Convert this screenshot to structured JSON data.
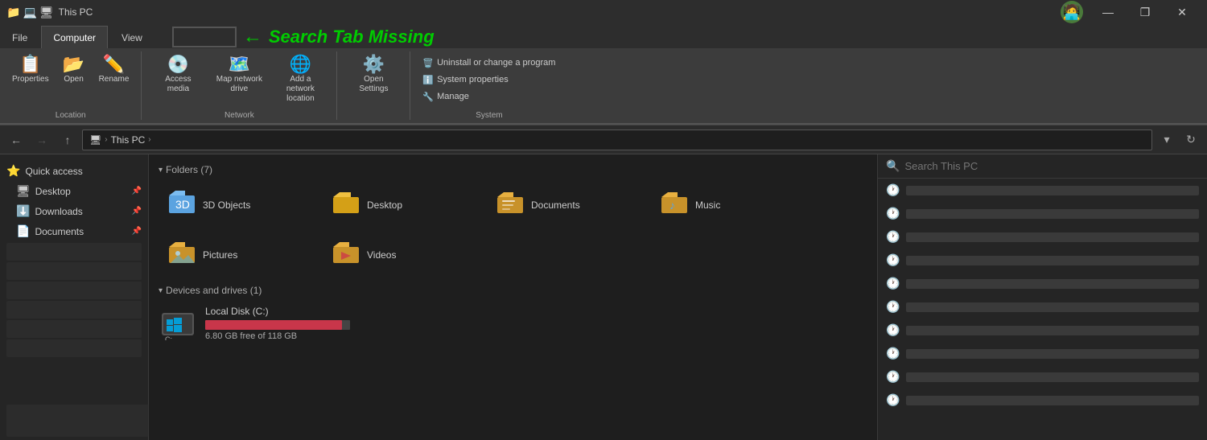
{
  "titleBar": {
    "title": "This PC",
    "icons": [
      "📁",
      "💻",
      "🖥"
    ],
    "controls": [
      "—",
      "❐",
      "✕"
    ]
  },
  "ribbonTabs": [
    {
      "label": "File",
      "active": false
    },
    {
      "label": "Computer",
      "active": true
    },
    {
      "label": "View",
      "active": false
    }
  ],
  "ribbon": {
    "groups": [
      {
        "label": "Location",
        "items": [
          {
            "label": "Properties",
            "icon": "📋",
            "size": "large"
          },
          {
            "label": "Open",
            "icon": "📂",
            "size": "large"
          },
          {
            "label": "Rename",
            "icon": "✏️",
            "size": "large"
          }
        ]
      },
      {
        "label": "",
        "items": [
          {
            "label": "Access media",
            "icon": "💿",
            "size": "large"
          },
          {
            "label": "Map network drive",
            "icon": "🗺️",
            "size": "large"
          },
          {
            "label": "Add a network location",
            "icon": "🌐",
            "size": "large"
          }
        ]
      },
      {
        "label": "Network",
        "items": []
      },
      {
        "label": "",
        "items": [
          {
            "label": "Open Settings",
            "icon": "⚙️",
            "size": "large"
          }
        ]
      },
      {
        "label": "System",
        "smallItems": [
          {
            "label": "Uninstall or change a program",
            "icon": "🗑️"
          },
          {
            "label": "System properties",
            "icon": "ℹ️"
          },
          {
            "label": "Manage",
            "icon": "🔧"
          }
        ]
      }
    ],
    "searchMissing": {
      "text": "Search Tab Missing",
      "arrow": "←"
    }
  },
  "navBar": {
    "backDisabled": false,
    "forwardDisabled": true,
    "upDisabled": false,
    "addressPath": [
      "🖥",
      "This PC"
    ],
    "refreshIcon": "↻"
  },
  "sidebar": {
    "items": [
      {
        "label": "Quick access",
        "icon": "⭐",
        "pinned": false
      },
      {
        "label": "Desktop",
        "icon": "🖥",
        "pinned": true
      },
      {
        "label": "Downloads",
        "icon": "⬇️",
        "pinned": true
      },
      {
        "label": "Documents",
        "icon": "📄",
        "pinned": true
      }
    ],
    "blurredCount": 6
  },
  "content": {
    "foldersSection": {
      "label": "Folders",
      "count": 7,
      "folders": [
        {
          "name": "3D Objects",
          "color": "#5ba3e0"
        },
        {
          "name": "Desktop",
          "color": "#f0c040"
        },
        {
          "name": "Documents",
          "color": "#f0c040"
        },
        {
          "name": "Music",
          "color": "#f0c040"
        },
        {
          "name": "Pictures",
          "color": "#f0c040"
        },
        {
          "name": "Videos",
          "color": "#f0c040"
        }
      ]
    },
    "devicesSection": {
      "label": "Devices and drives",
      "count": 1,
      "drives": [
        {
          "name": "Local Disk (C:)",
          "freeSpace": "6.80 GB free of 118 GB",
          "usedPercent": 94.2,
          "color": "#c8364a"
        }
      ]
    }
  },
  "searchPanel": {
    "placeholder": "Search This PC",
    "historyItems": [
      {
        "text": ""
      },
      {
        "text": ""
      },
      {
        "text": ""
      },
      {
        "text": ""
      },
      {
        "text": ""
      },
      {
        "text": ""
      },
      {
        "text": ""
      },
      {
        "text": ""
      },
      {
        "text": ""
      },
      {
        "text": ""
      }
    ]
  }
}
